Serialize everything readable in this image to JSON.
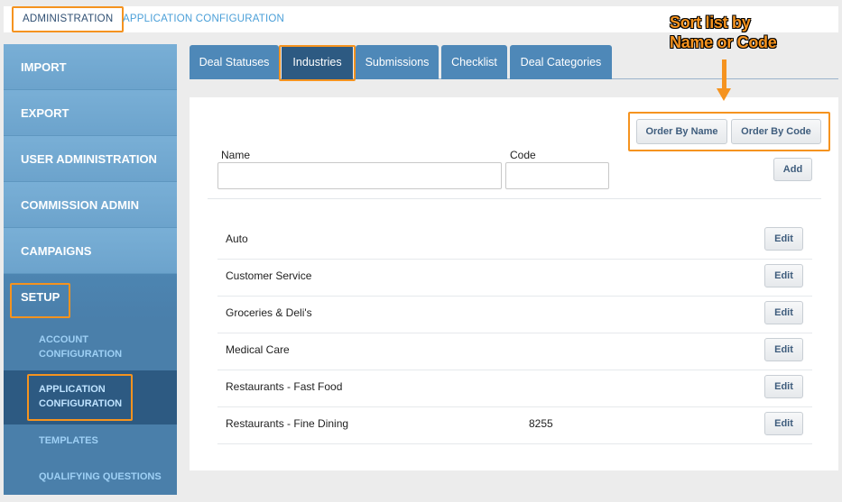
{
  "breadcrumb": {
    "admin": "ADMINISTRATION",
    "current": "APPLICATION CONFIGURATION"
  },
  "sidebar": {
    "items": [
      {
        "label": "IMPORT"
      },
      {
        "label": "EXPORT"
      },
      {
        "label": "USER ADMINISTRATION"
      },
      {
        "label": "COMMISSION ADMIN"
      },
      {
        "label": "CAMPAIGNS"
      },
      {
        "label": "SETUP"
      }
    ],
    "sub_items": [
      {
        "line1": "ACCOUNT",
        "line2": "CONFIGURATION"
      },
      {
        "line1": "APPLICATION",
        "line2": "CONFIGURATION"
      },
      {
        "line1": "TEMPLATES",
        "line2": ""
      },
      {
        "line1": "QUALIFYING QUESTIONS",
        "line2": ""
      }
    ]
  },
  "tabs": [
    {
      "label": "Deal Statuses"
    },
    {
      "label": "Industries"
    },
    {
      "label": "Submissions"
    },
    {
      "label": "Checklist"
    },
    {
      "label": "Deal Categories"
    }
  ],
  "annotation": {
    "line1": "Sort list by",
    "line2": "Name or Code"
  },
  "order": {
    "by_name": "Order By Name",
    "by_code": "Order By Code"
  },
  "form": {
    "name_label": "Name",
    "code_label": "Code",
    "name_value": "",
    "code_value": "",
    "add_label": "Add"
  },
  "rows": [
    {
      "name": "Auto",
      "code": "",
      "edit": "Edit"
    },
    {
      "name": "Customer Service",
      "code": "",
      "edit": "Edit"
    },
    {
      "name": "Groceries & Deli's",
      "code": "",
      "edit": "Edit"
    },
    {
      "name": "Medical Care",
      "code": "",
      "edit": "Edit"
    },
    {
      "name": "Restaurants - Fast Food",
      "code": "",
      "edit": "Edit"
    },
    {
      "name": "Restaurants - Fine Dining",
      "code": "8255",
      "edit": "Edit"
    }
  ],
  "colors": {
    "highlight": "#f5931f",
    "sidebar": "#6ea6cf",
    "active_nav": "#2d5a82",
    "tab": "#4e88b8",
    "link": "#4a9fd8"
  }
}
